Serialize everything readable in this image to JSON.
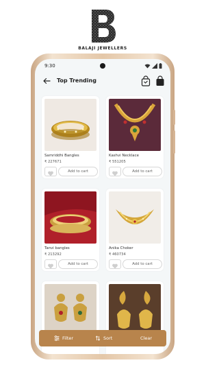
{
  "brand": {
    "name": "BALAJI JEWELLERS"
  },
  "status_bar": {
    "time": "9:30"
  },
  "header": {
    "title": "Top Trending",
    "back_icon": "arrow-left-icon",
    "action_icons": [
      "shopping-bag-icon",
      "cart-bag-icon"
    ]
  },
  "products": [
    {
      "name": "Samriddhi Bangles",
      "price": "₹ 227671",
      "cart_label": "Add to cart",
      "image": "gold-bangles-photo"
    },
    {
      "name": "Kashvi Necklace",
      "price": "₹ 551205",
      "cart_label": "Add to cart",
      "image": "gold-necklace-photo"
    },
    {
      "name": "Tanvi bangles",
      "price": "₹ 213292",
      "cart_label": "Add to cart",
      "image": "gold-bangles-red-photo"
    },
    {
      "name": "Anika Choker",
      "price": "₹ 460734",
      "cart_label": "Add to cart",
      "image": "gold-choker-photo"
    },
    {
      "name": "",
      "price": "",
      "cart_label": "",
      "image": "jhumka-earrings-photo"
    },
    {
      "name": "",
      "price": "",
      "cart_label": "",
      "image": "peacock-jhumka-photo"
    }
  ],
  "bottom_bar": {
    "filter_label": "Filter",
    "sort_label": "Sort",
    "clear_label": "Clear"
  },
  "colors": {
    "accent": "#b8844c",
    "screen_bg": "#f4f7f8",
    "frame": "#e4c7a8"
  }
}
